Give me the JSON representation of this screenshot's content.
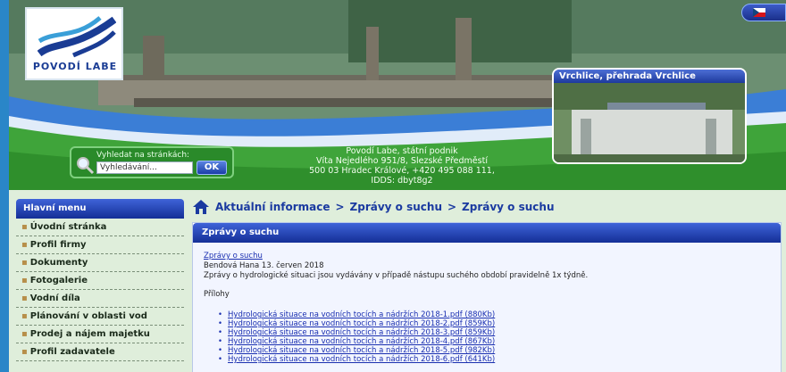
{
  "header": {
    "logo_text": "POVODÍ  LABE",
    "flag": "czech-flag",
    "photo_caption": "Vrchlice, přehrada Vrchlice",
    "search": {
      "label": "Vyhledat na stránkách:",
      "placeholder": "Vyhledávání...",
      "button_label": "OK"
    },
    "address_lines": [
      "Povodí Labe, státní podnik",
      "Víta Nejedlého 951/8, Slezské Předměstí",
      "500 03 Hradec Králové, +420 495 088 111,",
      "IDDS: dbyt8g2"
    ]
  },
  "sidebar": {
    "title": "Hlavní menu",
    "items": [
      {
        "label": "Úvodní stránka"
      },
      {
        "label": "Profil firmy"
      },
      {
        "label": "Dokumenty"
      },
      {
        "label": "Fotogalerie"
      },
      {
        "label": "Vodní díla"
      },
      {
        "label": "Plánování v oblasti vod"
      },
      {
        "label": "Prodej a nájem majetku"
      },
      {
        "label": "Profil zadavatele"
      }
    ]
  },
  "breadcrumb": {
    "items": [
      "Aktuální informace",
      "Zprávy o suchu",
      "Zprávy o suchu"
    ],
    "separator": ">"
  },
  "panel": {
    "title": "Zprávy o suchu",
    "article_link": "Zprávy o suchu",
    "meta": "Bendová Hana  13. červen 2018",
    "description": "Zprávy o hydrologické situaci jsou vydávány v případě nástupu suchého období pravidelně 1x týdně.",
    "attachments_label": "Přílohy",
    "attachments": [
      "Hydrologická situace na vodních tocích a nádržích 2018-1.pdf (880Kb)",
      "Hydrologická situace na vodních tocích a nádržích 2018-2.pdf (859Kb)",
      "Hydrologická situace na vodních tocích a nádržích 2018-3.pdf (859Kb)",
      "Hydrologická situace na vodních tocích a nádržích 2018-4.pdf (867Kb)",
      "Hydrologická situace na vodních tocích a nádržích 2018-5.pdf (982Kb)",
      "Hydrologická situace na vodních tocích a nádržích 2018-6.pdf (641Kb)"
    ]
  },
  "colors": {
    "page_bg": "#2a86c8",
    "menu_blue": "#1f3fb0",
    "content_bg": "#dfeedb",
    "link": "#1a2fb0"
  }
}
